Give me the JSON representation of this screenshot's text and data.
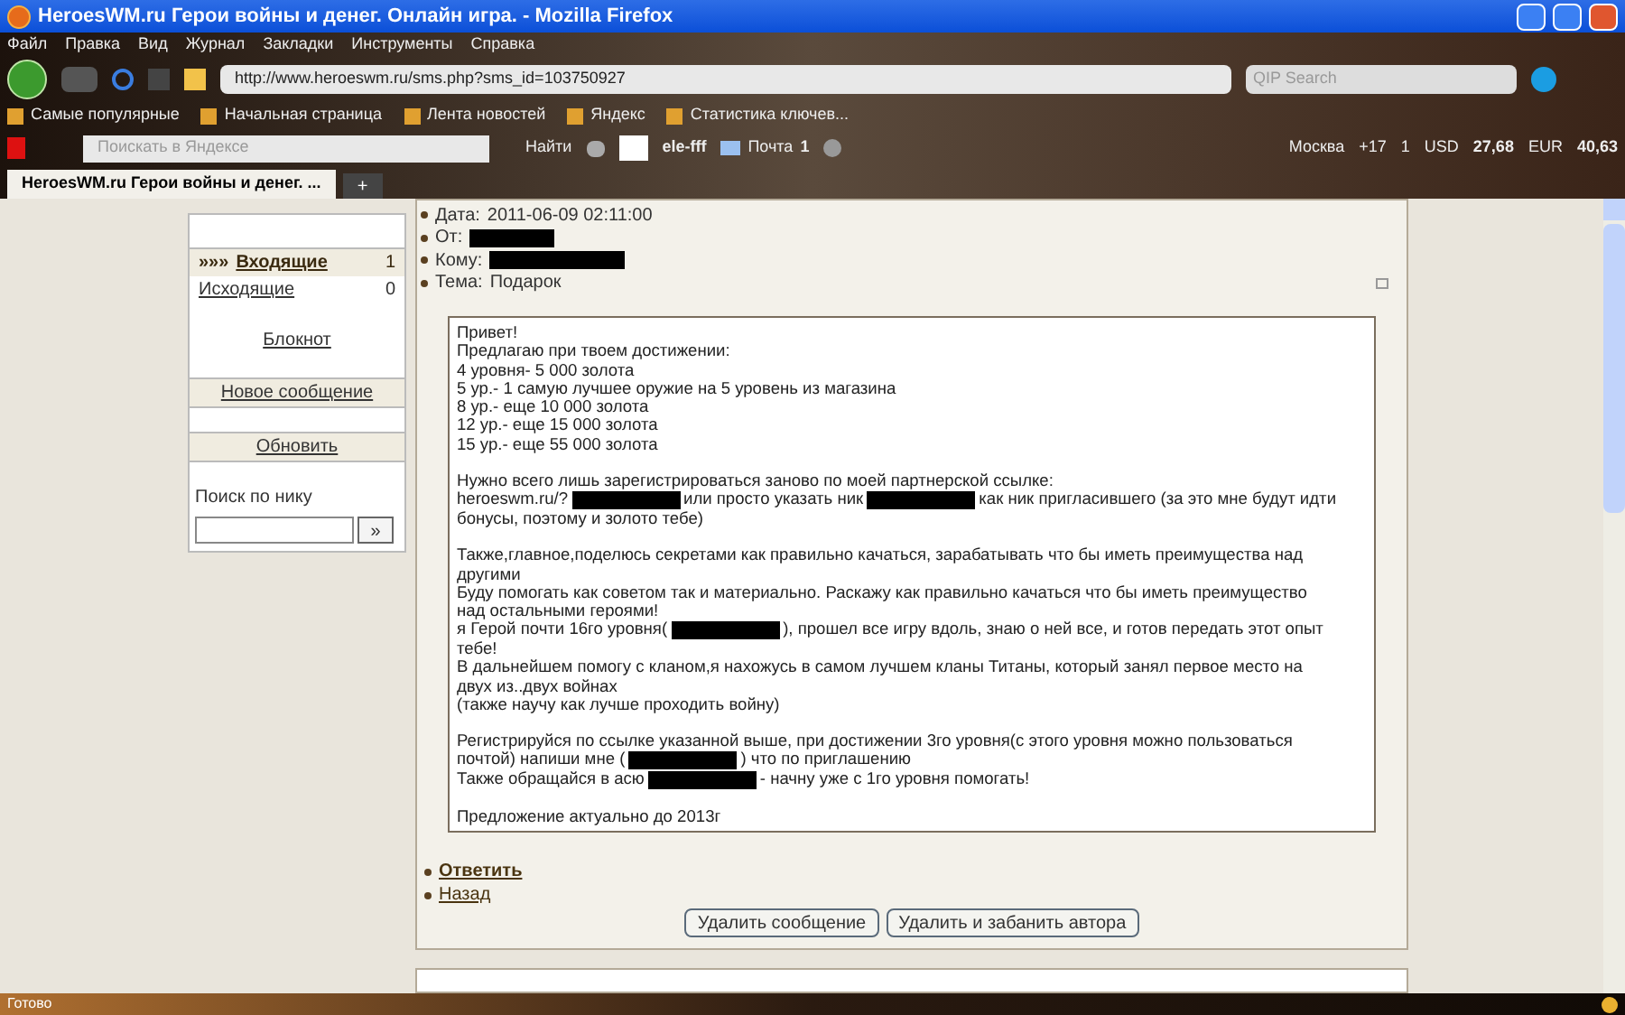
{
  "window": {
    "title": "HeroesWM.ru Герои войны и денег. Онлайн игра. - Mozilla Firefox"
  },
  "menu": [
    "Файл",
    "Правка",
    "Вид",
    "Журнал",
    "Закладки",
    "Инструменты",
    "Справка"
  ],
  "address_bar": {
    "url": "http://www.heroeswm.ru/sms.php?sms_id=103750927"
  },
  "qip_search": {
    "placeholder": "QIP Search"
  },
  "bookmarks": [
    "Самые популярные",
    "Начальная страница",
    "Лента новостей",
    "Яндекс",
    "Статистика ключев..."
  ],
  "yandex_bar": {
    "placeholder": "Поискать в Яндексе",
    "find": "Найти",
    "user": "ele-fff",
    "mail": "Почта",
    "mail_count": "1",
    "city": "Москва",
    "temperature": "+17",
    "counter": "1",
    "usd_label": "USD",
    "usd": "27,68",
    "eur_label": "EUR",
    "eur": "40,63"
  },
  "tabs": [
    {
      "label": "HeroesWM.ru Герои войны и денег. ...",
      "selected": true
    }
  ],
  "new_tab": "+",
  "sidebar": {
    "folders": [
      {
        "prefix": "»»»",
        "label": "Входящие",
        "count": "1",
        "selected": true
      },
      {
        "label": "Исходящие",
        "count": "0",
        "selected": false
      }
    ],
    "links": [
      "Блокнот",
      "Новое сообщение",
      "Обновить"
    ],
    "search_label": "Поиск по нику",
    "search_button": "»"
  },
  "message": {
    "fields": [
      {
        "label": "Дата:",
        "value": "2011-06-09 02:11:00",
        "kind": "text"
      },
      {
        "label": "От:",
        "kind": "redacted"
      },
      {
        "label": "Кому:",
        "kind": "redacted"
      },
      {
        "label": "Тема:",
        "value": "Подарок",
        "kind": "text"
      }
    ],
    "paragraphs": [
      [
        [
          {
            "kind": "text",
            "text": "Привет!"
          }
        ],
        [
          {
            "kind": "text",
            "text": "Предлагаю при твоем достижении:"
          }
        ],
        [
          {
            "kind": "text",
            "text": "4 уровня- 5 000 золота"
          }
        ],
        [
          {
            "kind": "text",
            "text": "5 ур.- 1 самую лучшее оружие на 5 уровень из магазина"
          }
        ],
        [
          {
            "kind": "text",
            "text": "8 ур.- еще 10 000 золота"
          }
        ],
        [
          {
            "kind": "text",
            "text": "12 ур.- еще 15 000 золота"
          }
        ],
        [
          {
            "kind": "text",
            "text": "15 ур.- еще 55 000 золота"
          }
        ]
      ],
      [
        [
          {
            "kind": "text",
            "text": "Нужно всего лишь зарегистрироваться заново по моей партнерской ссылке:"
          }
        ],
        [
          {
            "kind": "text",
            "text": "heroeswm.ru/?"
          },
          {
            "kind": "redacted"
          },
          {
            "kind": "text",
            "text": "или просто указать ник"
          },
          {
            "kind": "redacted"
          },
          {
            "kind": "text",
            "text": "как ник пригласившего (за это мне будут идти"
          }
        ],
        [
          {
            "kind": "text",
            "text": "бонусы, поэтому и золото тебе)"
          }
        ]
      ],
      [
        [
          {
            "kind": "text",
            "text": "Также,главное,поделюсь секретами как правильно качаться, зарабатывать что бы иметь преимущества над"
          }
        ],
        [
          {
            "kind": "text",
            "text": "другими"
          }
        ],
        [
          {
            "kind": "text",
            "text": "Буду помогать как советом так и материально. Раскажу как правильно качаться что бы иметь преимущество"
          }
        ],
        [
          {
            "kind": "text",
            "text": "над остальными героями!"
          }
        ],
        [
          {
            "kind": "text",
            "text": "я Герой почти 16го уровня("
          },
          {
            "kind": "redacted"
          },
          {
            "kind": "text",
            "text": "), прошел все игру вдоль, знаю о ней все, и готов передать этот опыт"
          }
        ],
        [
          {
            "kind": "text",
            "text": "тебе!"
          }
        ],
        [
          {
            "kind": "text",
            "text": "В дальнейшем помогу с кланом,я нахожусь в самом лучшем кланы Титаны, который занял первое место на"
          }
        ],
        [
          {
            "kind": "text",
            "text": "двух из..двух войнах"
          }
        ],
        [
          {
            "kind": "text",
            "text": "(также научу как лучше проходить войну)"
          }
        ]
      ],
      [
        [
          {
            "kind": "text",
            "text": "Регистрируйся по ссылке указанной выше, при достижении 3го уровня(с этого уровня можно пользоваться"
          }
        ],
        [
          {
            "kind": "text",
            "text": "почтой) напиши мне ("
          },
          {
            "kind": "redacted"
          },
          {
            "kind": "text",
            "text": ") что по приглашению"
          }
        ],
        [
          {
            "kind": "text",
            "text": "Также обращайся в асю"
          },
          {
            "kind": "redacted"
          },
          {
            "kind": "text",
            "text": "- начну уже с 1го уровня помогать!"
          }
        ]
      ],
      [
        [
          {
            "kind": "text",
            "text": "Предложение актуально до 2013г"
          }
        ]
      ]
    ],
    "actions": [
      {
        "label": "Ответить",
        "bold": true
      },
      {
        "label": "Назад",
        "bold": false
      }
    ],
    "buttons": [
      "Удалить сообщение",
      "Удалить и забанить автора"
    ]
  },
  "status_bar": {
    "text": "Готово"
  }
}
